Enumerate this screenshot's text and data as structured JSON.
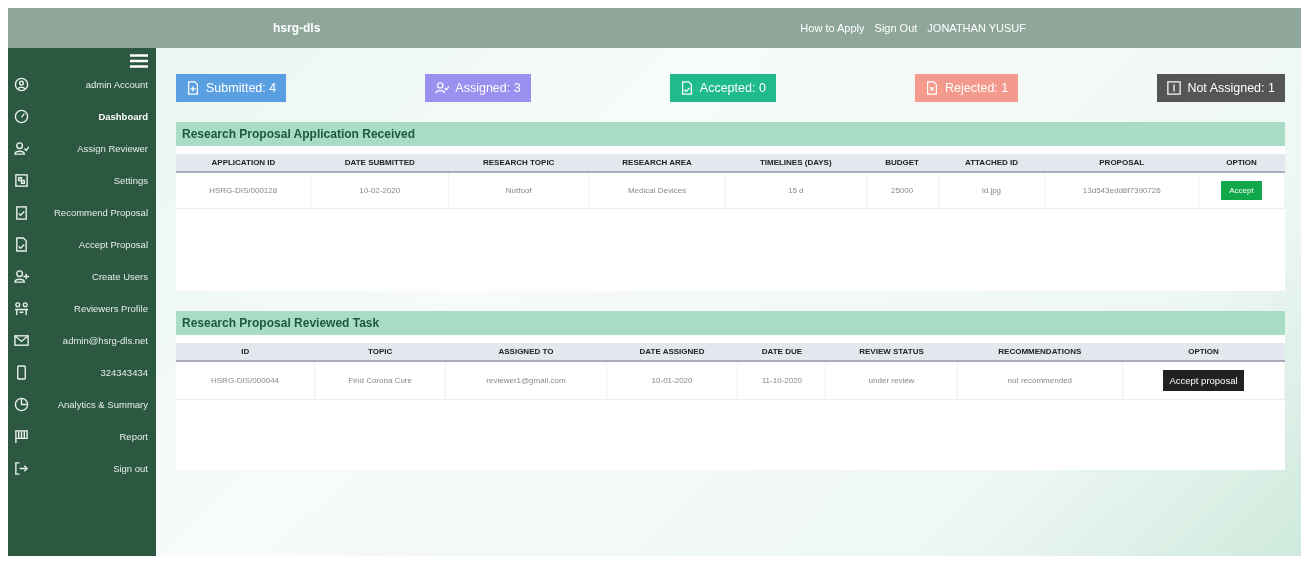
{
  "header": {
    "title": "hsrg-dls",
    "links": [
      "How to Apply",
      "Sign Out"
    ],
    "user": "JONATHAN YUSUF"
  },
  "sidebar": {
    "items": [
      {
        "label": "admin Account",
        "selected": false
      },
      {
        "label": "Dashboard",
        "selected": true
      },
      {
        "label": "Assign Reviewer",
        "selected": false
      },
      {
        "label": "Settings",
        "selected": false
      },
      {
        "label": "Recommend Proposal",
        "selected": false
      },
      {
        "label": "Accept Proposal",
        "selected": false
      },
      {
        "label": "Create Users",
        "selected": false
      },
      {
        "label": "Reviewers Profile",
        "selected": false
      },
      {
        "label": "admin@hsrg-dls.net",
        "selected": false
      },
      {
        "label": "324343434",
        "selected": false
      },
      {
        "label": "Analytics & Summary",
        "selected": false
      },
      {
        "label": "Report",
        "selected": false
      },
      {
        "label": "Sign out",
        "selected": false
      }
    ]
  },
  "stats": [
    {
      "label": "Submitted: 4",
      "color": "#5b9fe3"
    },
    {
      "label": "Assigned: 3",
      "color": "#9b8ff0"
    },
    {
      "label": "Accepted: 0",
      "color": "#1fbb8a"
    },
    {
      "label": "Rejected: 1",
      "color": "#f49a8c"
    },
    {
      "label": "Not Assigned: 1",
      "color": "#555555"
    }
  ],
  "received": {
    "title": "Research Proposal Application Received",
    "columns": [
      "APPLICATION ID",
      "DATE SUBMITTED",
      "RESEARCH TOPIC",
      "RESEARCH AREA",
      "TIMELINES (DAYS)",
      "BUDGET",
      "ATTACHED ID",
      "PROPOSAL",
      "OPTION"
    ],
    "rows": [
      {
        "cells": [
          "HSRG-DIS/000128",
          "10-02-2020",
          "Nutfoof",
          "Medical Devices",
          "15 d",
          "25000",
          "id.jpg",
          "13d543edd8f7390726"
        ],
        "action": "Accept"
      }
    ]
  },
  "reviewed": {
    "title": "Research Proposal Reviewed Task",
    "columns": [
      "ID",
      "TOPIC",
      "ASSIGNED TO",
      "DATE ASSIGNED",
      "DATE DUE",
      "REVIEW STATUS",
      "RECOMMENDATIONS",
      "OPTION"
    ],
    "rows": [
      {
        "cells": [
          "HSRG-DIS/000044",
          "Find Corona Cure",
          "reviewer1@gmail.com",
          "10-01-2020",
          "11-10-2020",
          "under review",
          "not recommended"
        ],
        "action": "Accept proposal"
      }
    ]
  }
}
